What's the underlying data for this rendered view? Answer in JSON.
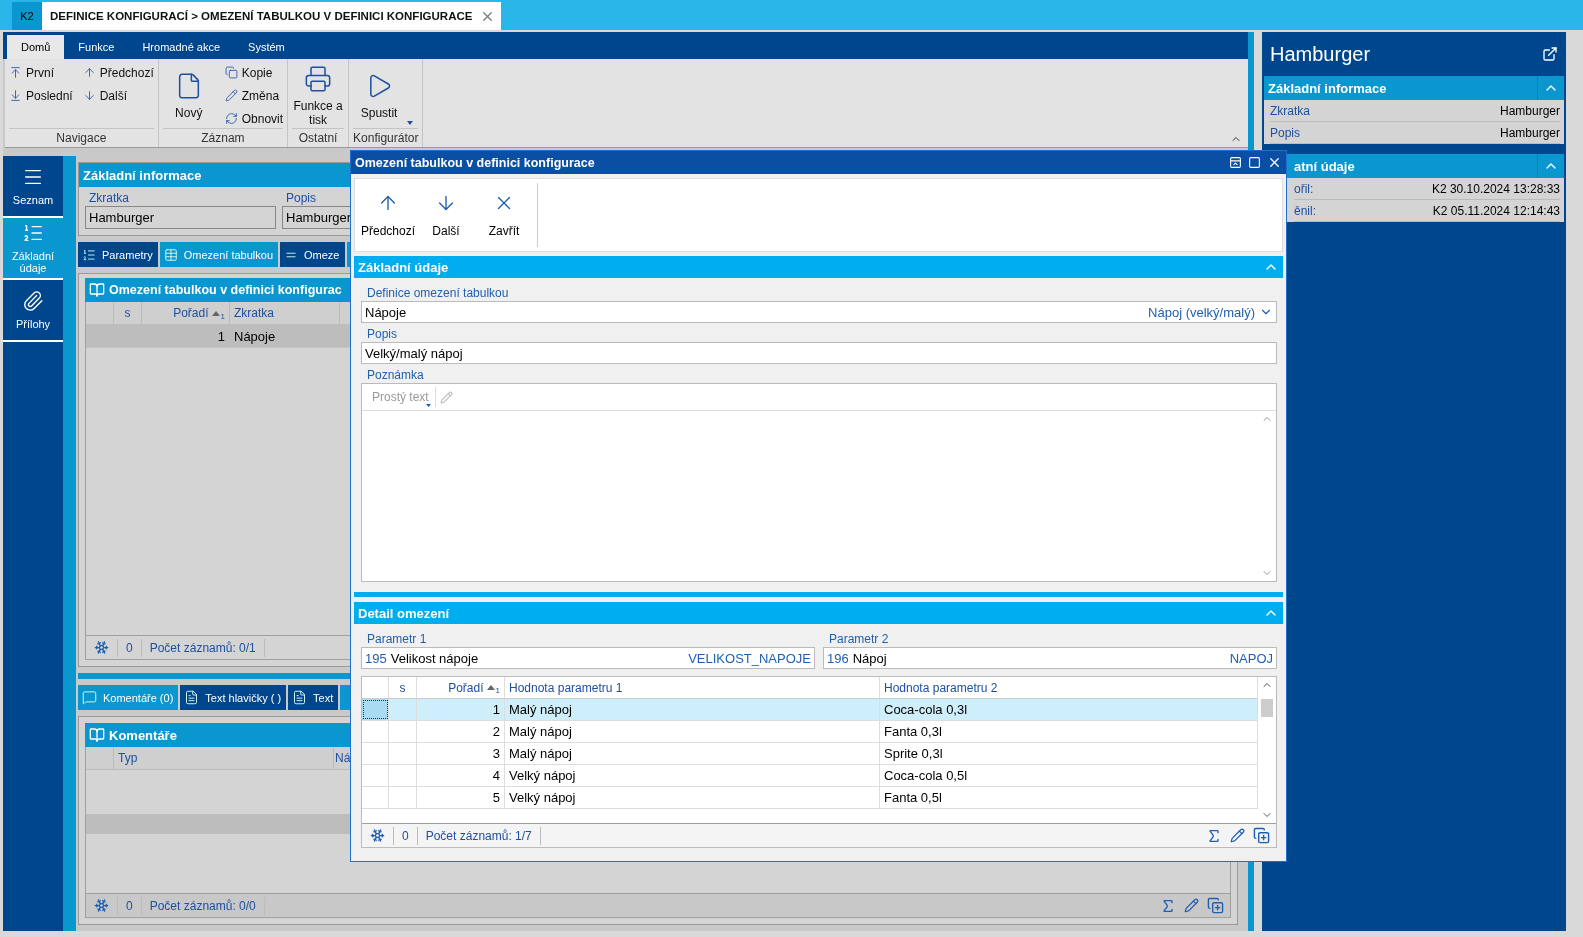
{
  "title_bar": {
    "badge": "K2",
    "tab_title": "DEFINICE KONFIGURACÍ > OMEZENÍ TABULKOU V DEFINICI KONFIGURACE"
  },
  "ribbon": {
    "tabs": [
      {
        "label": "Domů",
        "selected": true
      },
      {
        "label": "Funkce",
        "selected": false
      },
      {
        "label": "Hromadné akce",
        "selected": false
      },
      {
        "label": "Systém",
        "selected": false
      }
    ],
    "groups": [
      {
        "label": "Navigace",
        "columns": [
          [
            {
              "kind": "small",
              "label": "První"
            },
            {
              "kind": "small",
              "label": "Poslední"
            }
          ],
          [
            {
              "kind": "small",
              "label": "Předchozí"
            },
            {
              "kind": "small",
              "label": "Další"
            }
          ]
        ]
      },
      {
        "label": "Záznam",
        "columns": [
          [
            {
              "kind": "large",
              "label": "Nový"
            }
          ],
          [
            {
              "kind": "small",
              "label": "Kopie"
            },
            {
              "kind": "small",
              "label": "Změna"
            },
            {
              "kind": "small",
              "label": "Obnovit"
            }
          ]
        ]
      },
      {
        "label": "Ostatní",
        "columns": [
          [
            {
              "kind": "large",
              "label": "Funkce a tisk"
            }
          ]
        ]
      },
      {
        "label": "Konfigurátor",
        "columns": [
          [
            {
              "kind": "large",
              "label": "Spustit"
            }
          ]
        ]
      }
    ]
  },
  "nav": [
    {
      "label": "Seznam",
      "selected": false
    },
    {
      "label": "Základní údaje",
      "selected": true
    },
    {
      "label": "Přílohy",
      "selected": false
    }
  ],
  "basic_info": {
    "title": "Základní informace",
    "fields": [
      {
        "label": "Zkratka",
        "value": "Hamburger"
      },
      {
        "label": "Popis",
        "value": "Hamburger"
      }
    ]
  },
  "upper_tabs": [
    {
      "label": "Parametry",
      "selected": false
    },
    {
      "label": "Omezení tabulkou",
      "selected": true
    },
    {
      "label": "Omeze",
      "selected": false
    }
  ],
  "upper_grid": {
    "title": "Omezení tabulkou v definici konfigurac",
    "columns": [
      {
        "label": "s"
      },
      {
        "label": "Pořadí",
        "sort_index": "1"
      },
      {
        "label": "Zkratka"
      }
    ],
    "rows": [
      {
        "order": "1",
        "code": "Nápoje",
        "selected": true
      }
    ],
    "status": {
      "count": "0",
      "records": "Počet záznamů: 0/1"
    }
  },
  "lower_tabs": [
    {
      "label": "Komentáře (0)",
      "selected": true
    },
    {
      "label": "Text hlavičky ( )",
      "selected": false
    },
    {
      "label": "Text",
      "selected": false
    }
  ],
  "comments_grid": {
    "title": "Komentáře",
    "columns": [
      "Typ",
      "Ná"
    ],
    "status": {
      "count": "0",
      "records": "Počet záznamů: 0/0"
    }
  },
  "side_panel": {
    "title": "Hamburger",
    "sections": [
      {
        "title": "Základní informace",
        "rows": [
          {
            "label": "Zkratka",
            "value": "Hamburger"
          },
          {
            "label": "Popis",
            "value": "Hamburger"
          }
        ]
      },
      {
        "title": "atní údaje",
        "rows": [
          {
            "label": "ořil:",
            "value": "K2 30.10.2024 13:28:33"
          },
          {
            "label": "ěnil:",
            "value": "K2 05.11.2024 12:14:43"
          }
        ]
      }
    ]
  },
  "dialog": {
    "title": "Omezení tabulkou v definici konfigurace",
    "toolbar": [
      {
        "label": "Předchozí"
      },
      {
        "label": "Další"
      },
      {
        "label": "Zavřít"
      }
    ],
    "basic_section": {
      "title": "Základní údaje",
      "definition": {
        "label": "Definice omezení tabulkou",
        "value": "Nápoje",
        "hint": "Nápoj (velký/malý)"
      },
      "description": {
        "label": "Popis",
        "value": "Velký/malý nápoj"
      },
      "note": {
        "label": "Poznámka",
        "format": "Prostý text"
      }
    },
    "detail_section": {
      "title": "Detail omezení",
      "params": [
        {
          "label": "Parametr 1",
          "number": "195",
          "name": "Velikost nápoje",
          "code": "VELIKOST_NAPOJE"
        },
        {
          "label": "Parametr 2",
          "number": "196",
          "name": "Nápoj",
          "code": "NAPOJ"
        }
      ],
      "grid": {
        "columns": [
          {
            "label": "s"
          },
          {
            "label": "Pořadí",
            "sort_index": "1"
          },
          {
            "label": "Hodnota parametru 1"
          },
          {
            "label": "Hodnota parametru 2"
          }
        ],
        "rows": [
          {
            "order": "1",
            "value_1": "Malý nápoj",
            "value_2": "Coca-cola 0,3l",
            "selected": true
          },
          {
            "order": "2",
            "value_1": "Malý nápoj",
            "value_2": "Fanta 0,3l",
            "selected": false
          },
          {
            "order": "3",
            "value_1": "Malý nápoj",
            "value_2": "Sprite 0,3l",
            "selected": false
          },
          {
            "order": "4",
            "value_1": "Velký nápoj",
            "value_2": "Coca-cola 0,5l",
            "selected": false
          },
          {
            "order": "5",
            "value_1": "Velký nápoj",
            "value_2": "Fanta 0,5l",
            "selected": false
          }
        ],
        "status": {
          "count": "0",
          "records": "Počet záznamů: 1/7"
        }
      }
    }
  }
}
